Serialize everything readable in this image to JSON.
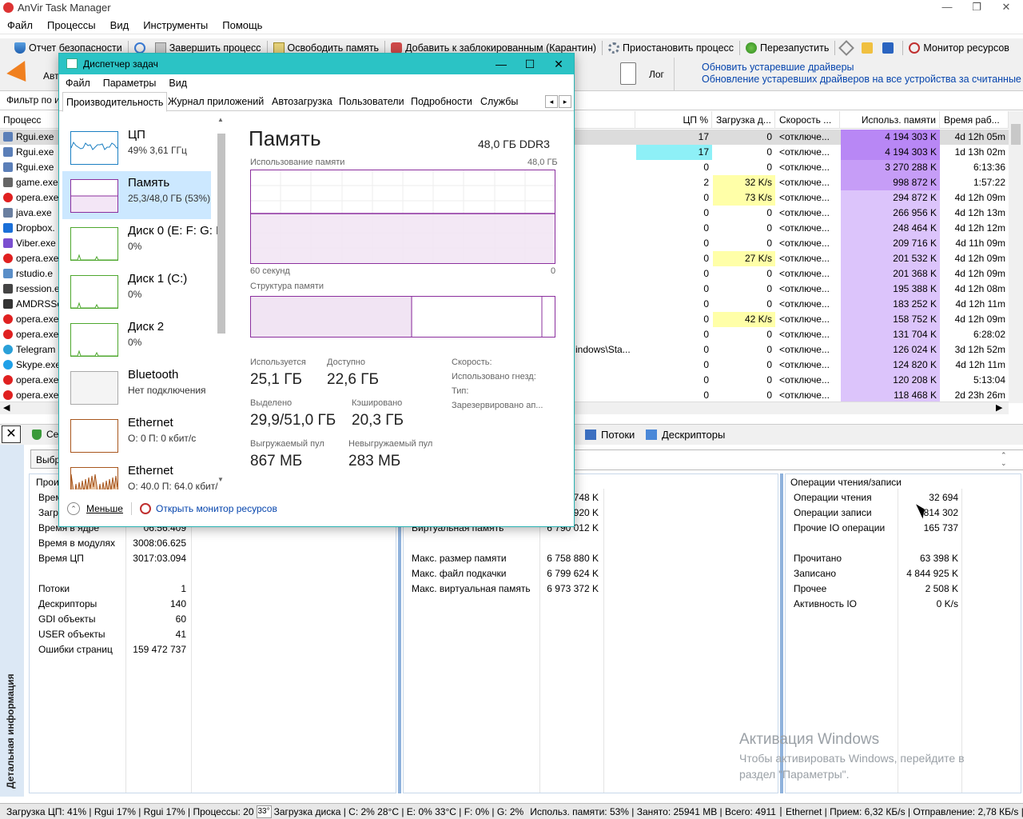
{
  "app": {
    "title": "AnVir Task Manager",
    "wc": [
      "—",
      "❐",
      "✕"
    ]
  },
  "menu": [
    "Файл",
    "Процессы",
    "Вид",
    "Инструменты",
    "Помощь"
  ],
  "toolbar": [
    "Отчет безопасности",
    "Завершить процесс",
    "Освободить память",
    "Добавить к заблокированным (Карантин)",
    "Приостановить процесс",
    "Перезапустить",
    "Монитор ресурсов"
  ],
  "bigbar": {
    "autostart": "Авт",
    "log": "Лог",
    "link1": "Обновить устаревшие драйверы",
    "link2": "Обновление устаревших драйверов на все устройства за считанные"
  },
  "filter": {
    "label": "Фильтр по и"
  },
  "grid": {
    "headers": {
      "process": "Процесс",
      "cpu": "ЦП %",
      "disk": "Загрузка д...",
      "speed": "Скорость ...",
      "mem": "Использ. памяти",
      "time": "Время раб..."
    },
    "rows": [
      {
        "name": "Rgui.exe",
        "path": "",
        "cpu": "17",
        "disk": "0",
        "speed": "<отключе...",
        "mem": "4 194 303 K",
        "time": "4d 12h 05m",
        "icon": "rgui-icon"
      },
      {
        "name": "Rgui.exe",
        "path": "",
        "cpu": "17",
        "disk": "0",
        "speed": "<отключе...",
        "mem": "4 194 303 K",
        "time": "1d 13h 02m",
        "icon": "rgui-icon"
      },
      {
        "name": "Rgui.exe",
        "path": "",
        "cpu": "0",
        "disk": "0",
        "speed": "<отключе...",
        "mem": "3 270 288 K",
        "time": "6:13:36",
        "icon": "rgui-icon"
      },
      {
        "name": "game.exe",
        "path": "",
        "cpu": "2",
        "disk": "32 K/s",
        "speed": "<отключе...",
        "mem": "998 872 K",
        "time": "1:57:22",
        "icon": "game-icon"
      },
      {
        "name": "opera.exe",
        "path": "",
        "cpu": "0",
        "disk": "73 K/s",
        "speed": "<отключе...",
        "mem": "294 872 K",
        "time": "4d 12h 09m",
        "icon": "opera-icon"
      },
      {
        "name": "java.exe",
        "path": "",
        "cpu": "0",
        "disk": "0",
        "speed": "<отключе...",
        "mem": "266 956 K",
        "time": "4d 12h 13m",
        "icon": "java-icon"
      },
      {
        "name": "Dropbox.",
        "path": "",
        "cpu": "0",
        "disk": "0",
        "speed": "<отключе...",
        "mem": "248 464 K",
        "time": "4d 12h 12m",
        "icon": "dropbox-icon"
      },
      {
        "name": "Viber.exe",
        "path": "",
        "cpu": "0",
        "disk": "0",
        "speed": "<отключе...",
        "mem": "209 716 K",
        "time": "4d 11h 09m",
        "icon": "viber-icon"
      },
      {
        "name": "opera.exe",
        "path": "",
        "cpu": "0",
        "disk": "27 K/s",
        "speed": "<отключе...",
        "mem": "201 532 K",
        "time": "4d 12h 09m",
        "icon": "opera-icon"
      },
      {
        "name": "rstudio.e",
        "path": "",
        "cpu": "0",
        "disk": "0",
        "speed": "<отключе...",
        "mem": "201 368 K",
        "time": "4d 12h 09m",
        "icon": "rstudio-icon"
      },
      {
        "name": "rsession.e",
        "path": "",
        "cpu": "0",
        "disk": "0",
        "speed": "<отключе...",
        "mem": "195 388 K",
        "time": "4d 12h 08m",
        "icon": "rsession-icon"
      },
      {
        "name": "AMDRSSe",
        "path": "",
        "cpu": "0",
        "disk": "0",
        "speed": "<отключе...",
        "mem": "183 252 K",
        "time": "4d 12h 11m",
        "icon": "amd-icon"
      },
      {
        "name": "opera.exe",
        "path": "",
        "cpu": "0",
        "disk": "42 K/s",
        "speed": "<отключе...",
        "mem": "158 752 K",
        "time": "4d 12h 09m",
        "icon": "opera-icon"
      },
      {
        "name": "opera.exe",
        "path": "",
        "cpu": "0",
        "disk": "0",
        "speed": "<отключе...",
        "mem": "131 704 K",
        "time": "6:28:02",
        "icon": "opera-icon"
      },
      {
        "name": "Telegram",
        "path": "indows\\Sta...",
        "cpu": "0",
        "disk": "0",
        "speed": "<отключе...",
        "mem": "126 024 K",
        "time": "3d 12h 52m",
        "icon": "telegram-icon"
      },
      {
        "name": "Skype.exe",
        "path": "",
        "cpu": "0",
        "disk": "0",
        "speed": "<отключе...",
        "mem": "124 820 K",
        "time": "4d 12h 11m",
        "icon": "skype-icon"
      },
      {
        "name": "opera.exe",
        "path": "",
        "cpu": "0",
        "disk": "0",
        "speed": "<отключе...",
        "mem": "120 208 K",
        "time": "5:13:04",
        "icon": "opera-icon"
      },
      {
        "name": "opera.exe",
        "path": "",
        "cpu": "0",
        "disk": "0",
        "speed": "<отключе...",
        "mem": "118 468 K",
        "time": "2d 23h 26m",
        "icon": "opera-icon"
      }
    ]
  },
  "lower": {
    "tabs": {
      "services": "Се",
      "threads": "Потоки",
      "handles": "Дескрипторы"
    },
    "select_btn": "Выбр",
    "side": "Детальная информация",
    "proc_group": "Прои",
    "left": [
      {
        "k": "Врем",
        "v": ""
      },
      {
        "k": "Загр",
        "v": ""
      },
      {
        "k": "Время в ядре",
        "v": "06:56.409"
      },
      {
        "k": "Время в модулях",
        "v": "3008:06.625"
      },
      {
        "k": "Время ЦП",
        "v": "3017:03.094"
      },
      {
        "k": "Потоки",
        "v": "1"
      },
      {
        "k": "Дескрипторы",
        "v": "140"
      },
      {
        "k": "GDI объекты",
        "v": "60"
      },
      {
        "k": "USER объекты",
        "v": "41"
      },
      {
        "k": "Ошибки страниц",
        "v": "159 472 737"
      }
    ],
    "mid": [
      {
        "k": "",
        "v": "748 K"
      },
      {
        "k": "",
        "v": "920 K"
      },
      {
        "k": "Виртуальная память",
        "v": "6 790 012 K"
      },
      {
        "k": "Макс. размер памяти",
        "v": "6 758 880 K"
      },
      {
        "k": "Макс. файл подкачки",
        "v": "6 799 624 K"
      },
      {
        "k": "Макс. виртуальная память",
        "v": "6 973 372 K"
      }
    ],
    "io_title": "Операции чтения/записи",
    "right": [
      {
        "k": "Операции чтения",
        "v": "32 694"
      },
      {
        "k": "Операции записи",
        "v": "814 302"
      },
      {
        "k": "Прочие IO операции",
        "v": "165 737"
      },
      {
        "k": "Прочитано",
        "v": "63 398 K"
      },
      {
        "k": "Записано",
        "v": "4 844 925 K"
      },
      {
        "k": "Прочее",
        "v": "2 508 K"
      },
      {
        "k": "Активность IO",
        "v": "0 K/s"
      }
    ]
  },
  "watermark": {
    "title": "Активация Windows",
    "text": "Чтобы активировать Windows, перейдите в раздел \"Параметры\"."
  },
  "status": {
    "cpu": "Загрузка ЦП: 41% | Rgui 17% | Rgui 17% | Процессы: 20",
    "temp_badge": "33°",
    "disk": "Загрузка диска | C: 2% 28°C | E: 0% 33°C | F: 0% | G: 2%",
    "mem": "Использ. памяти: 53% | Занято: 25941 MB | Всего: 4911",
    "net": "Ethernet | Прием: 6,32 КБ/s | Отправление: 2,78 КБ/s | Пр"
  },
  "tm": {
    "title": "Диспетчер задач",
    "wc": [
      "—",
      "☐",
      "✕"
    ],
    "menu": [
      "Файл",
      "Параметры",
      "Вид"
    ],
    "tabs": [
      "Производительность",
      "Журнал приложений",
      "Автозагрузка",
      "Пользователи",
      "Подробности",
      "Службы"
    ],
    "resources": [
      {
        "name": "ЦП",
        "sub": "49% 3,61 ГГц",
        "color": "#1b7fc2"
      },
      {
        "name": "Память",
        "sub": "25,3/48,0 ГБ (53%)",
        "color": "#8b2f9e"
      },
      {
        "name": "Диск 0 (E: F: G: H",
        "sub": "0%",
        "color": "#4ea72e"
      },
      {
        "name": "Диск 1 (C:)",
        "sub": "0%",
        "color": "#4ea72e"
      },
      {
        "name": "Диск 2",
        "sub": "0%",
        "color": "#4ea72e"
      },
      {
        "name": "Bluetooth",
        "sub": "Нет подключения",
        "color": "#aaaaaa"
      },
      {
        "name": "Ethernet",
        "sub": "О: 0 П: 0 кбит/с",
        "color": "#a8561d"
      },
      {
        "name": "Ethernet",
        "sub": "О: 40,0 П: 64,0 кбит/",
        "color": "#a8561d"
      }
    ],
    "mem": {
      "heading": "Память",
      "total": "48,0 ГБ DDR3",
      "usage_label": "Использование памяти",
      "usage_max": "48,0 ГБ",
      "time_left": "60 секунд",
      "time_right": "0",
      "struct_label": "Структура памяти",
      "used_fraction": 0.53,
      "in_use_label": "Используется",
      "in_use": "25,1 ГБ",
      "avail_label": "Доступно",
      "avail": "22,6 ГБ",
      "committed_label": "Выделено",
      "committed": "29,9/51,0 ГБ",
      "cached_label": "Кэшировано",
      "cached": "20,3 ГБ",
      "paged_label": "Выгружаемый пул",
      "paged": "867 МБ",
      "nonpaged_label": "Невыгружаемый пул",
      "nonpaged": "283 МБ",
      "speed_label": "Скорость:",
      "slots_label": "Использовано гнезд:",
      "form_label": "Тип:",
      "reserved_label": "Зарезервировано ап..."
    },
    "footer": {
      "less": "Меньше",
      "monitor": "Открыть монитор ресурсов"
    }
  },
  "colors": {
    "tm_title": "#2bc3c5",
    "mem_purple": "#8b2f9e",
    "cpu_cyan": "#8ef0f7",
    "disk_yellow": "#ffffa8",
    "mem_heat": "#c8a0ff"
  }
}
